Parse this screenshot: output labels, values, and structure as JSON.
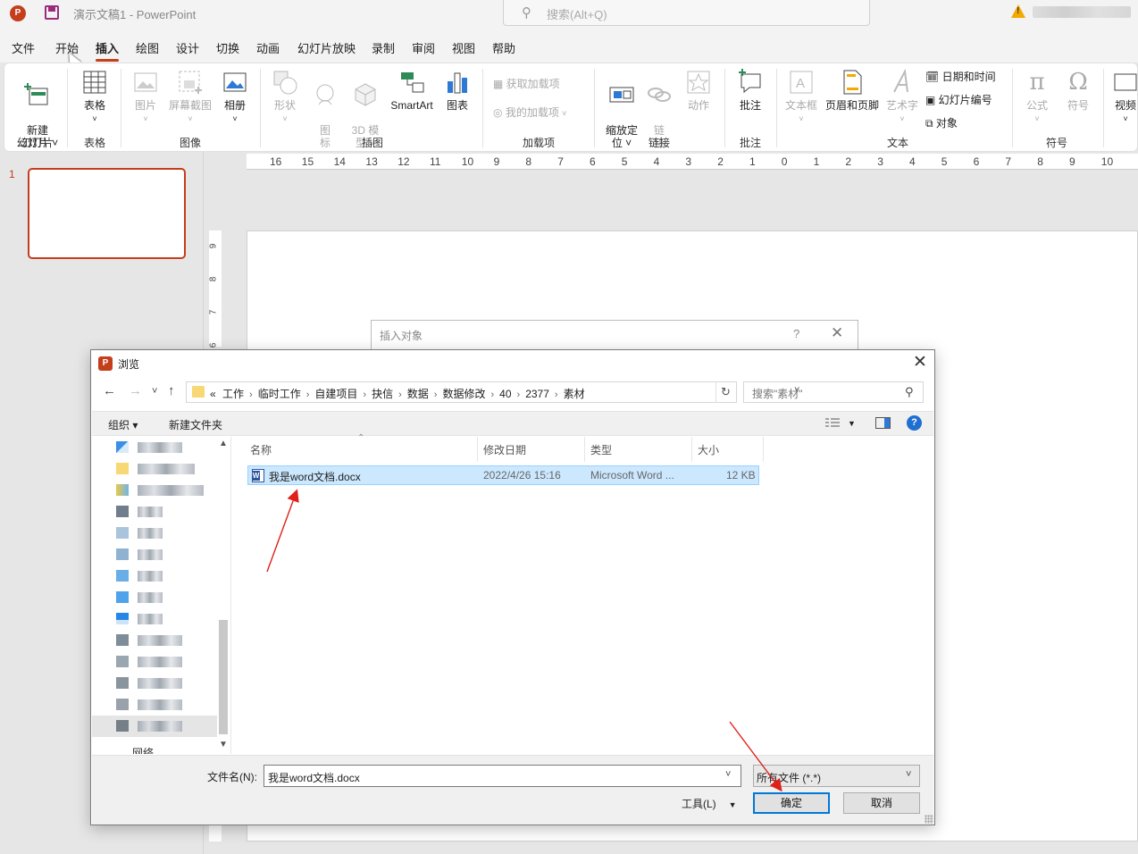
{
  "titlebar": {
    "app_logo": "P",
    "doc_title": "演示文稿1  -  PowerPoint",
    "search_placeholder": "搜索(Alt+Q)"
  },
  "menu": [
    "文件",
    "开始",
    "插入",
    "绘图",
    "设计",
    "切换",
    "动画",
    "幻灯片放映",
    "录制",
    "审阅",
    "视图",
    "帮助"
  ],
  "menu_active": "插入",
  "ribbon": {
    "new_slide": "新建\n幻灯片 ˅",
    "table": "表格",
    "picture": "图片",
    "screenshot": "屏幕截图",
    "album": "相册",
    "shapes": "形状",
    "icons": "图\n标",
    "models3d": "3D 模\n型 ˅",
    "smartart": "SmartArt",
    "chart": "图表",
    "get_addins": "获取加载项",
    "my_addins": "我的加载项",
    "zoom": "缩放定\n位 ˅",
    "link": "链\n接",
    "action": "动作",
    "comment": "批注",
    "textbox": "文本框",
    "header_footer": "页眉和页脚",
    "wordart": "艺术字",
    "date_time": "日期和时间",
    "slide_number": "幻灯片编号",
    "object": "对象",
    "equation": "公式",
    "symbol": "符号",
    "video": "视频",
    "groups": {
      "slides": "幻灯片",
      "tables": "表格",
      "images": "图像",
      "illustrations": "插图",
      "addins": "加载项",
      "links": "链接",
      "comments": "批注",
      "text": "文本",
      "symbols": "符号"
    }
  },
  "slide_pane": {
    "slide_number": "1"
  },
  "ruler_h": [
    "16",
    "15",
    "14",
    "13",
    "12",
    "11",
    "10",
    "9",
    "8",
    "7",
    "6",
    "5",
    "4",
    "3",
    "2",
    "1",
    "0",
    "1",
    "2",
    "3",
    "4",
    "5",
    "6",
    "7",
    "8",
    "9",
    "10"
  ],
  "ruler_v": [
    "9",
    "8",
    "7",
    "6"
  ],
  "insert_object_dialog": {
    "title": "插入对象",
    "help": "?",
    "close": "✕"
  },
  "browse_dialog": {
    "title": "浏览",
    "close": "✕",
    "nav": {
      "back": "←",
      "forward": "→",
      "recent": "˅",
      "up": "↑"
    },
    "address_prefix": "«",
    "breadcrumbs": [
      "工作",
      "临时工作",
      "自建项目",
      "抉信",
      "数据",
      "数据修改",
      "40",
      "2377",
      "素材"
    ],
    "search_placeholder": "搜索\"素材\"",
    "organize": "组织 ▾",
    "new_folder": "新建文件夹",
    "tree_network": "网络",
    "columns": {
      "name": "名称",
      "modified": "修改日期",
      "type": "类型",
      "size": "大小"
    },
    "files": [
      {
        "name": "我是word文档.docx",
        "modified": "2022/4/26 15:16",
        "type": "Microsoft Word ...",
        "size": "12 KB"
      }
    ],
    "filename_label": "文件名(N):",
    "filename_value": "我是word文档.docx",
    "filetype_value": "所有文件 (*.*)",
    "tools_label": "工具(L)",
    "ok_label": "确定",
    "cancel_label": "取消"
  },
  "colors": {
    "accent": "#c43e1c",
    "selection": "#cce8ff",
    "annotation_arrow": "#e0201a",
    "primary_border": "#0078d7"
  }
}
